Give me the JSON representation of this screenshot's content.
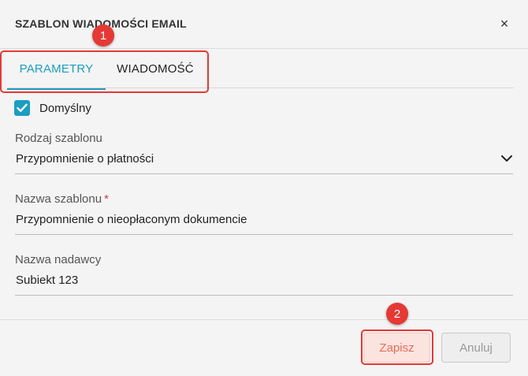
{
  "dialog": {
    "title": "SZABLON WIADOMOŚCI EMAIL",
    "close_icon": "×"
  },
  "tabs": [
    {
      "label": "PARAMETRY",
      "active": true
    },
    {
      "label": "WIADOMOŚĆ",
      "active": false
    }
  ],
  "default_checkbox": {
    "label": "Domyślny",
    "checked": true
  },
  "fields": {
    "template_type": {
      "label": "Rodzaj szablonu",
      "value": "Przypomnienie o płatności"
    },
    "template_name": {
      "label": "Nazwa szablonu",
      "required_mark": "*",
      "value": "Przypomnienie o nieopłaconym dokumencie"
    },
    "sender_name": {
      "label": "Nazwa nadawcy",
      "value": "Subiekt 123"
    }
  },
  "footer": {
    "save_label": "Zapisz",
    "cancel_label": "Anuluj"
  },
  "annotations": {
    "marker_1": "1",
    "marker_2": "2"
  },
  "colors": {
    "accent": "#1a9ec1",
    "annotation_red": "#e53935",
    "save_text": "#f06c56"
  }
}
